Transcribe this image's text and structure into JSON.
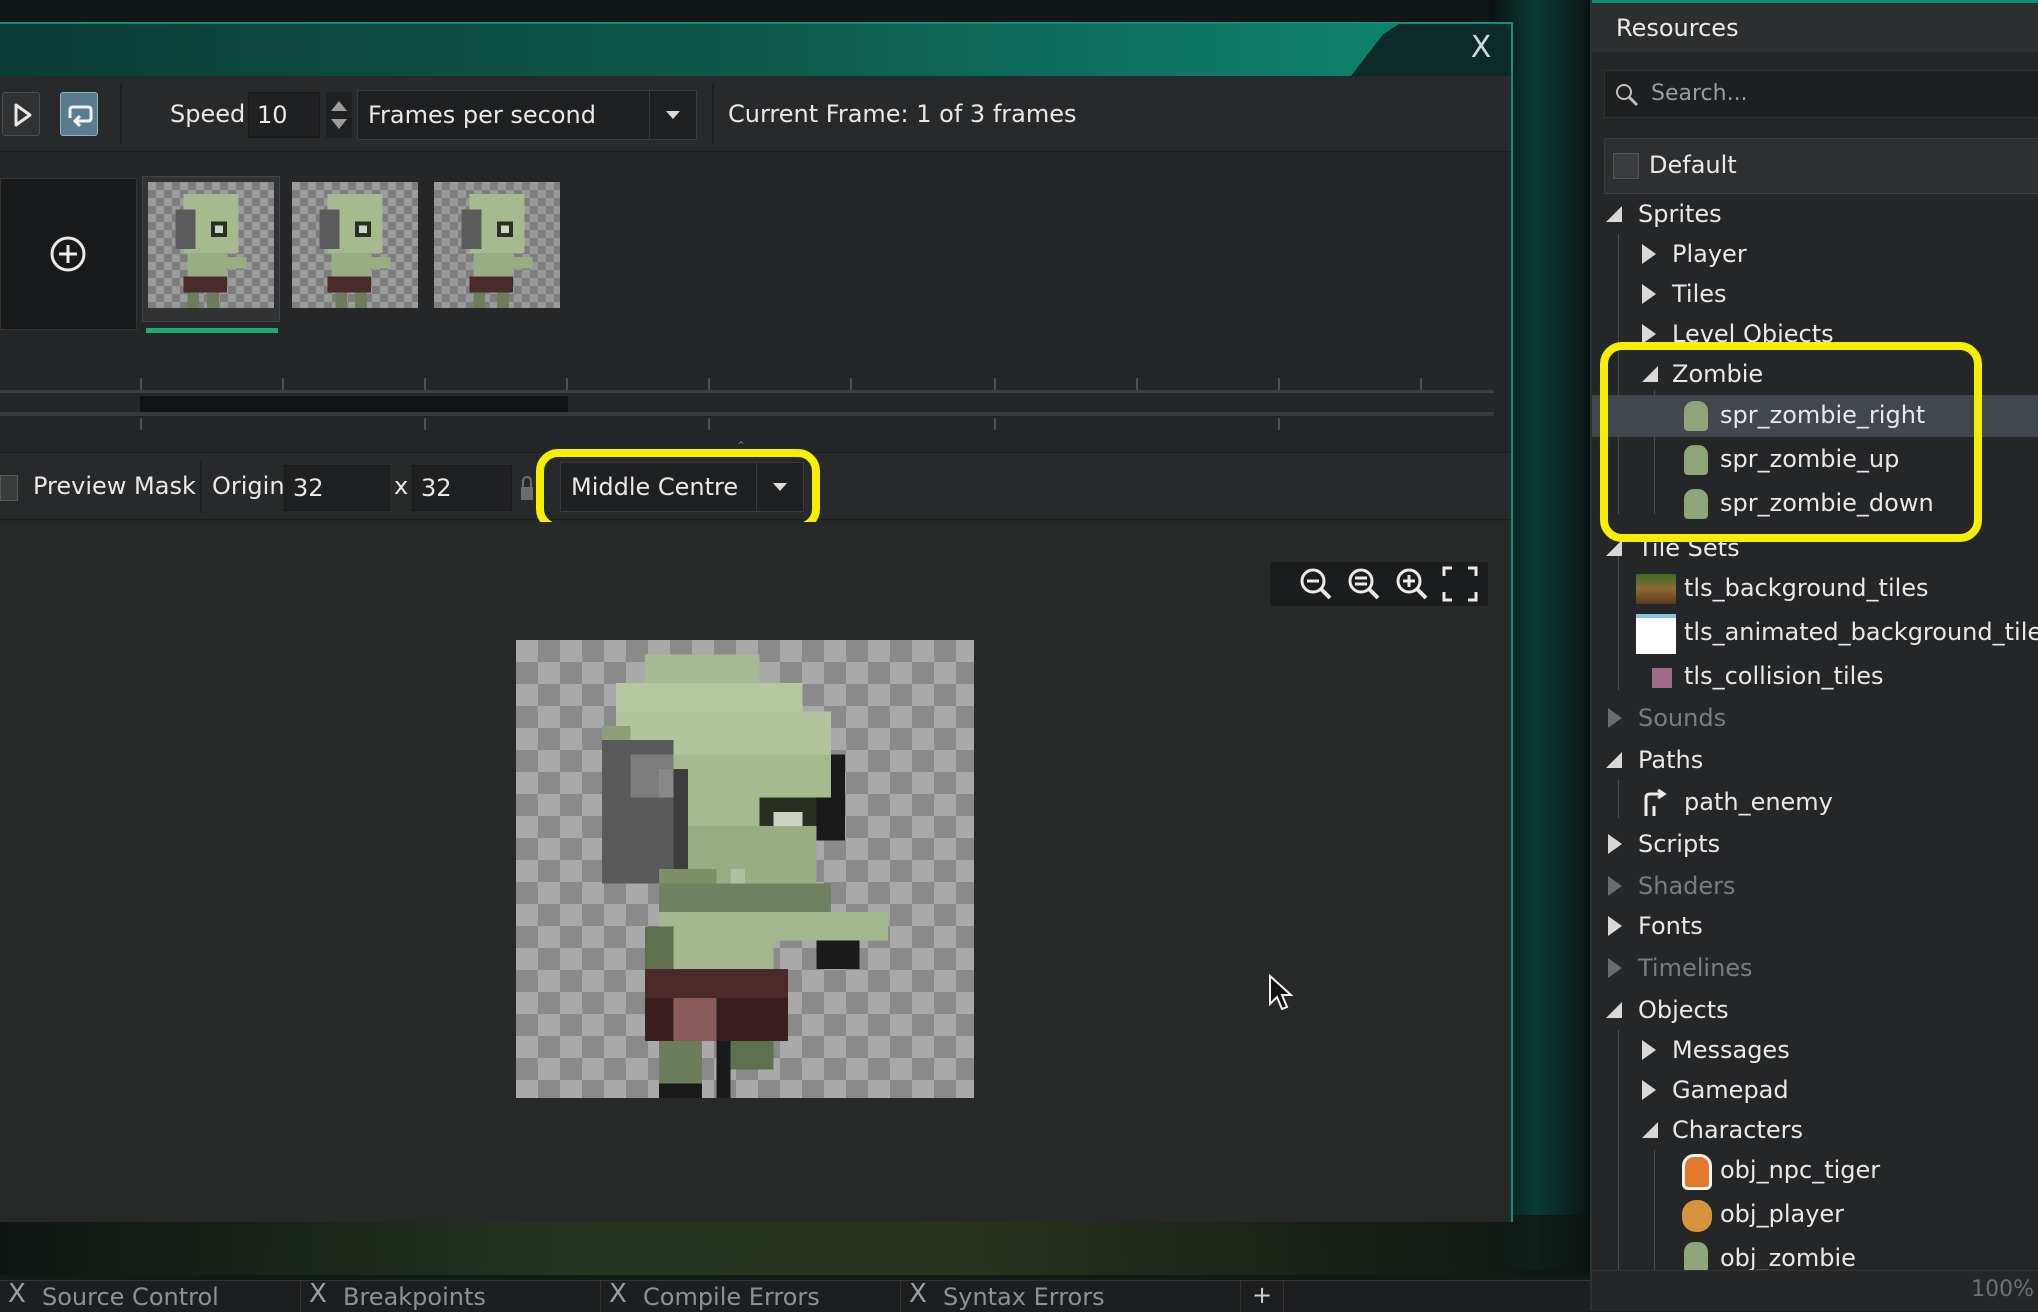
{
  "toolbar": {
    "speed_label": "Speed:",
    "speed_value": "10",
    "speed_unit": "Frames per second",
    "current_frame": "Current Frame: 1 of 3 frames"
  },
  "origin_bar": {
    "preview_mask": "Preview Mask",
    "origin_label": "Origin:",
    "origin_x": "32",
    "x_label": "x",
    "origin_y": "32",
    "origin_preset": "Middle Centre"
  },
  "window": {
    "close_glyph": "X"
  },
  "resources": {
    "title": "Resources",
    "search_placeholder": "Search...",
    "group": "Default",
    "tree": {
      "sprites": "Sprites",
      "player": "Player",
      "tiles": "Tiles",
      "level_objects": "Level Objects",
      "zombie": "Zombie",
      "spr_zombie_right": "spr_zombie_right",
      "spr_zombie_up": "spr_zombie_up",
      "spr_zombie_down": "spr_zombie_down",
      "tile_sets": "Tile Sets",
      "tls_background_tiles": "tls_background_tiles",
      "tls_animated_background_tiles": "tls_animated_background_tiles",
      "tls_collision_tiles": "tls_collision_tiles",
      "sounds": "Sounds",
      "paths": "Paths",
      "path_enemy": "path_enemy",
      "scripts": "Scripts",
      "shaders": "Shaders",
      "fonts": "Fonts",
      "timelines": "Timelines",
      "objects": "Objects",
      "messages": "Messages",
      "gamepad": "Gamepad",
      "characters": "Characters",
      "obj_npc_tiger": "obj_npc_tiger",
      "obj_player": "obj_player",
      "obj_zombie": "obj_zombie"
    },
    "zoom": "100%"
  },
  "bottom_tabs": [
    {
      "label": "Source Control"
    },
    {
      "label": "Breakpoints"
    },
    {
      "label": "Compile Errors"
    },
    {
      "label": "Syntax Errors"
    }
  ],
  "add_tab": "+",
  "colors": {
    "accent": "#0f8f75",
    "highlight": "#f5f000",
    "selected_frame": "#1fa870"
  }
}
